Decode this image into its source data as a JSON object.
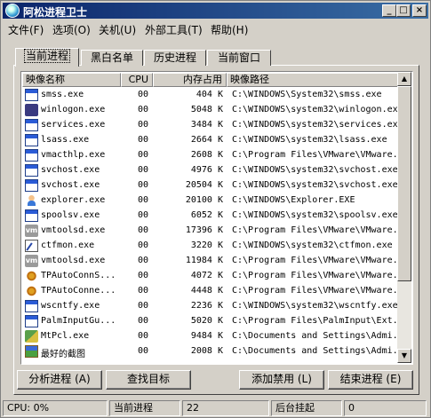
{
  "window": {
    "title": "阿松进程卫士",
    "minimize_label": "_",
    "maximize_label": "□",
    "close_label": "×"
  },
  "menu": [
    {
      "label": "文件(F)"
    },
    {
      "label": "选项(O)"
    },
    {
      "label": "关机(U)"
    },
    {
      "label": "外部工具(T)"
    },
    {
      "label": "帮助(H)"
    }
  ],
  "tabs": [
    {
      "label": "当前进程",
      "active": true
    },
    {
      "label": "黑白名单"
    },
    {
      "label": "历史进程"
    },
    {
      "label": "当前窗口"
    }
  ],
  "columns": {
    "name": "映像名称",
    "cpu": "CPU",
    "mem": "内存占用",
    "path": "映像路径"
  },
  "processes": [
    {
      "icon": "window-icon",
      "name": "smss.exe",
      "cpu": "00",
      "mem": "404 K",
      "path": "C:\\WINDOWS\\System32\\smss.exe"
    },
    {
      "icon": "lock-icon",
      "name": "winlogon.exe",
      "cpu": "00",
      "mem": "5048 K",
      "path": "C:\\WINDOWS\\system32\\winlogon.exe"
    },
    {
      "icon": "window-icon",
      "name": "services.exe",
      "cpu": "00",
      "mem": "3484 K",
      "path": "C:\\WINDOWS\\system32\\services.exe"
    },
    {
      "icon": "window-icon",
      "name": "lsass.exe",
      "cpu": "00",
      "mem": "2664 K",
      "path": "C:\\WINDOWS\\system32\\lsass.exe"
    },
    {
      "icon": "window-icon",
      "name": "vmacthlp.exe",
      "cpu": "00",
      "mem": "2608 K",
      "path": "C:\\Program Files\\VMware\\VMware..."
    },
    {
      "icon": "window-icon",
      "name": "svchost.exe",
      "cpu": "00",
      "mem": "4976 K",
      "path": "C:\\WINDOWS\\system32\\svchost.exe"
    },
    {
      "icon": "window-icon",
      "name": "svchost.exe",
      "cpu": "00",
      "mem": "20504 K",
      "path": "C:\\WINDOWS\\system32\\svchost.exe"
    },
    {
      "icon": "person-icon",
      "name": "explorer.exe",
      "cpu": "00",
      "mem": "20100 K",
      "path": "C:\\WINDOWS\\Explorer.EXE"
    },
    {
      "icon": "window-icon",
      "name": "spoolsv.exe",
      "cpu": "00",
      "mem": "6052 K",
      "path": "C:\\WINDOWS\\system32\\spoolsv.exe"
    },
    {
      "icon": "vm-icon",
      "name": "vmtoolsd.exe",
      "cpu": "00",
      "mem": "17396 K",
      "path": "C:\\Program Files\\VMware\\VMware..."
    },
    {
      "icon": "edit-icon",
      "name": "ctfmon.exe",
      "cpu": "00",
      "mem": "3220 K",
      "path": "C:\\WINDOWS\\system32\\ctfmon.exe"
    },
    {
      "icon": "vm-icon",
      "name": "vmtoolsd.exe",
      "cpu": "00",
      "mem": "11984 K",
      "path": "C:\\Program Files\\VMware\\VMware..."
    },
    {
      "icon": "gear-icon",
      "name": "TPAutoConnS...",
      "cpu": "00",
      "mem": "4072 K",
      "path": "C:\\Program Files\\VMware\\VMware..."
    },
    {
      "icon": "gear-icon",
      "name": "TPAutoConne...",
      "cpu": "00",
      "mem": "4448 K",
      "path": "C:\\Program Files\\VMware\\VMware..."
    },
    {
      "icon": "window-icon",
      "name": "wscntfy.exe",
      "cpu": "00",
      "mem": "2236 K",
      "path": "C:\\WINDOWS\\system32\\wscntfy.exe"
    },
    {
      "icon": "window-icon",
      "name": "PalmInputGu...",
      "cpu": "00",
      "mem": "5020 K",
      "path": "C:\\Program Files\\PalmInput\\Ext..."
    },
    {
      "icon": "tool-icon",
      "name": "MtPcl.exe",
      "cpu": "00",
      "mem": "9484 K",
      "path": "C:\\Documents and Settings\\Admi..."
    },
    {
      "icon": "image-icon",
      "name": "最好的截图",
      "cpu": "00",
      "mem": "2008 K",
      "path": "C:\\Documents and Settings\\Admi..."
    }
  ],
  "scrollbar": {
    "up": "▲",
    "down": "▼"
  },
  "buttons": {
    "analyze": "分析进程 (A)",
    "find": "查找目标",
    "add_ban": "添加禁用 (L)",
    "end": "结束进程 (E)"
  },
  "status": {
    "cpu": "CPU: 0%",
    "mode": "当前进程",
    "count": "22",
    "suspended": "后台挂起",
    "suspended_count": "0"
  }
}
